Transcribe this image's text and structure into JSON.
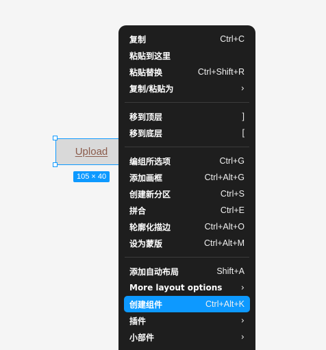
{
  "canvas": {
    "frame_label": "Upload",
    "size_badge": "105 × 40",
    "selection_color": "#0d99ff"
  },
  "menu": {
    "highlight_color": "#0d99ff",
    "background": "#1e1e1e",
    "groups": [
      [
        {
          "label": "复制",
          "shortcut": "Ctrl+C"
        },
        {
          "label": "粘贴到这里",
          "shortcut": ""
        },
        {
          "label": "粘贴替换",
          "shortcut": "Ctrl+Shift+R"
        },
        {
          "label": "复制/粘贴为",
          "shortcut": "›",
          "submenu": true
        }
      ],
      [
        {
          "label": "移到顶层",
          "shortcut": "]"
        },
        {
          "label": "移到底层",
          "shortcut": "["
        }
      ],
      [
        {
          "label": "编组所选项",
          "shortcut": "Ctrl+G"
        },
        {
          "label": "添加画框",
          "shortcut": "Ctrl+Alt+G"
        },
        {
          "label": "创建新分区",
          "shortcut": "Ctrl+S"
        },
        {
          "label": "拼合",
          "shortcut": "Ctrl+E"
        },
        {
          "label": "轮廓化描边",
          "shortcut": "Ctrl+Alt+O"
        },
        {
          "label": "设为蒙版",
          "shortcut": "Ctrl+Alt+M"
        }
      ],
      [
        {
          "label": "添加自动布局",
          "shortcut": "Shift+A"
        },
        {
          "label": "More layout options",
          "shortcut": "›",
          "submenu": true
        },
        {
          "label": "创建组件",
          "shortcut": "Ctrl+Alt+K",
          "highlighted": true
        },
        {
          "label": "插件",
          "shortcut": "›",
          "submenu": true
        },
        {
          "label": "小部件",
          "shortcut": "›",
          "submenu": true
        }
      ]
    ]
  }
}
